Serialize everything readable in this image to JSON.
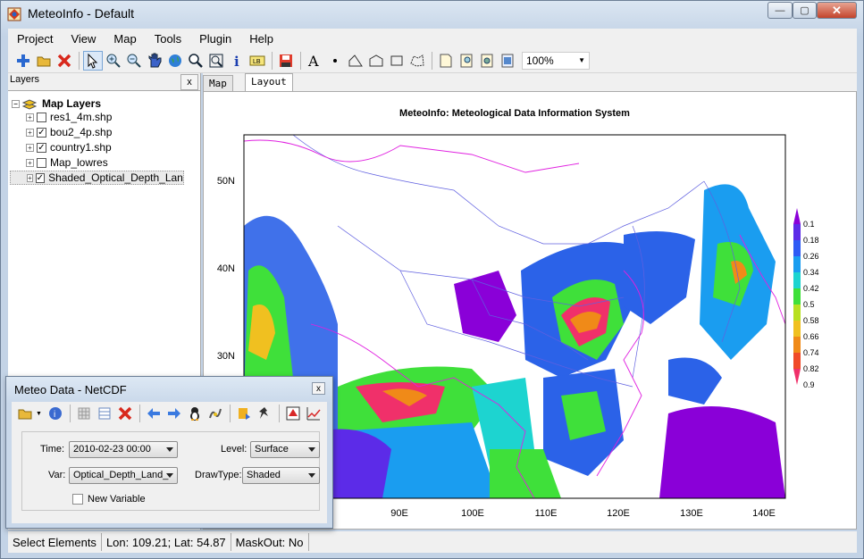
{
  "window": {
    "title": "MeteoInfo - Default",
    "minimize": "—",
    "maximize": "▢",
    "close": "✕"
  },
  "menu": [
    "Project",
    "View",
    "Map",
    "Tools",
    "Plugin",
    "Help"
  ],
  "toolbar": {
    "icons": [
      "add-layer-icon",
      "open-icon",
      "remove-icon",
      "|",
      "select-icon",
      "zoom-in-icon",
      "zoom-out-icon",
      "pan-icon",
      "full-extent-icon",
      "magnifier-icon",
      "zoom-to-layer-icon",
      "identify-icon",
      "label-icon",
      "|",
      "save-icon",
      "|",
      "text-icon",
      "point-icon",
      "polyline-icon",
      "polygon-icon",
      "rectangle-icon",
      "freehand-icon",
      "|",
      "page-setup-icon",
      "zoom-page-in-icon",
      "zoom-page-out-icon",
      "fit-page-icon"
    ],
    "zoom": "100%"
  },
  "layers": {
    "title": "Layers",
    "close": "x",
    "root": "Map Layers",
    "items": [
      {
        "label": "res1_4m.shp",
        "checked": false
      },
      {
        "label": "bou2_4p.shp",
        "checked": true
      },
      {
        "label": "country1.shp",
        "checked": true
      },
      {
        "label": "Map_lowres",
        "checked": false
      },
      {
        "label": "Shaded_Optical_Depth_Land_A",
        "checked": true
      }
    ]
  },
  "tabs": [
    "Map",
    "Layout"
  ],
  "map": {
    "title": "MeteoInfo: Meteological Data Information System",
    "lat_labels": [
      "50N",
      "40N",
      "30N"
    ],
    "lon_labels": [
      "90E",
      "100E",
      "110E",
      "120E",
      "130E",
      "140E"
    ],
    "legend": [
      "0.1",
      "0.18",
      "0.26",
      "0.34",
      "0.42",
      "0.5",
      "0.58",
      "0.66",
      "0.74",
      "0.82",
      "0.9"
    ],
    "legend_colors": [
      "#8a00d8",
      "#5c2be8",
      "#2f5bf5",
      "#1a9df0",
      "#1dd4d0",
      "#3fe03a",
      "#b8e020",
      "#f0c020",
      "#f08a18",
      "#f04a28",
      "#f0306a"
    ]
  },
  "status": {
    "mode": "Select Elements",
    "coords": "Lon: 109.21; Lat: 54.87",
    "maskout": "MaskOut: No"
  },
  "dialog": {
    "title": "Meteo Data - NetCDF",
    "close": "x",
    "time_label": "Time:",
    "time_value": "2010-02-23 00:00",
    "level_label": "Level:",
    "level_value": "Surface",
    "var_label": "Var:",
    "var_value": "Optical_Depth_Land_",
    "drawtype_label": "DrawType:",
    "drawtype_value": "Shaded",
    "new_variable": "New Variable"
  }
}
